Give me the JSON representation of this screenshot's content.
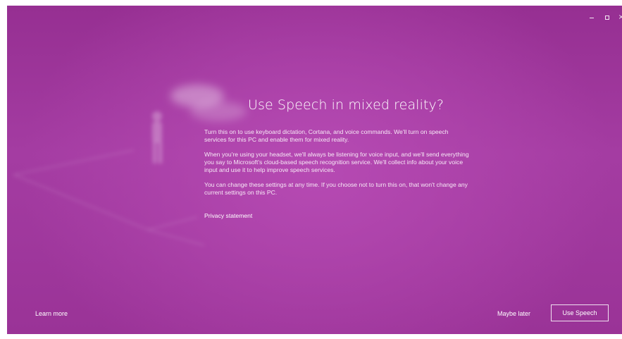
{
  "window": {
    "controls": {
      "minimize": "–",
      "maximize": "□",
      "close": "×"
    }
  },
  "dialog": {
    "title": "Use Speech in mixed reality?",
    "paragraphs": [
      "Turn this on to use keyboard dictation, Cortana, and voice commands. We'll turn on speech services for this PC and enable them for mixed reality.",
      "When you're using your headset, we'll always be listening for voice input, and we'll send everything you say to Microsoft's cloud-based speech recognition service. We'll collect info about your voice input and use it to help improve speech services.",
      "You can change these settings at any time. If you choose not to turn this on, that won't change any current settings on this PC."
    ],
    "privacy_link": "Privacy statement"
  },
  "footer": {
    "learn_more": "Learn more",
    "maybe_later": "Maybe later",
    "use_speech": "Use Speech"
  },
  "colors": {
    "background": "#a43ca2",
    "accent_light": "#b64ab3",
    "text": "#ffffff"
  },
  "icons": {
    "illustration": "headset-person-illustration"
  }
}
